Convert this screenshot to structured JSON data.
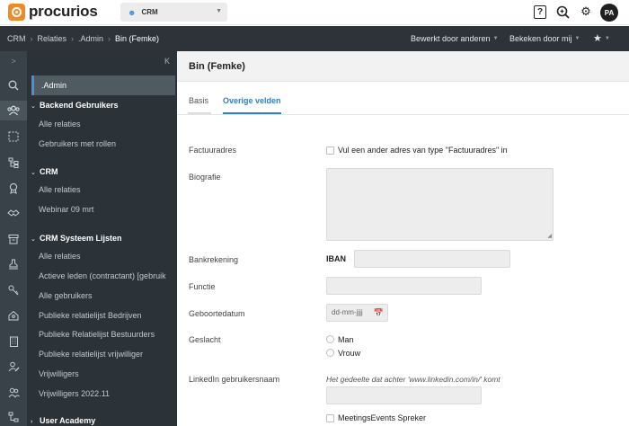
{
  "app": {
    "logo_text": "procurios",
    "module": "CRM",
    "avatar": "PA",
    "help": "?"
  },
  "breadcrumb": {
    "items": [
      "CRM",
      "Relaties",
      ".Admin"
    ],
    "current": "Bin (Femke)",
    "edited_by": "Bewerkt door anderen",
    "viewed_by": "Bekeken door mij"
  },
  "nav": {
    "collapse": "K",
    "rail_toggle": ">",
    "admin": ".Admin",
    "groups": [
      {
        "title": "Backend Gebruikers",
        "items": [
          "Alle relaties",
          "Gebruikers met rollen"
        ]
      },
      {
        "title": "CRM",
        "items": [
          "Alle relaties",
          "Webinar 09 mrt"
        ]
      },
      {
        "title": "CRM Systeem Lijsten",
        "items": [
          "Alle relaties",
          "Actieve leden (contractant) [gebruik",
          "Alle gebruikers",
          "Publieke relatielijst Bedrijven",
          "Publieke Relatielijst Bestuurders",
          "Publieke relatielijst vrijwilliger",
          "Vrijwilligers",
          "Vrijwilligers 2022.11"
        ]
      },
      {
        "title": "User Academy",
        "items": []
      }
    ]
  },
  "main": {
    "title": "Bin (Femke)",
    "tabs": [
      "Basis",
      "Overige velden"
    ],
    "active_tab": "Overige velden",
    "fields": {
      "factuuradres_label": "Factuuradres",
      "factuuradres_checkbox": "Vul een ander adres van type \"Factuuradres\" in",
      "biografie_label": "Biografie",
      "bankrekening_label": "Bankrekening",
      "iban_label": "IBAN",
      "functie_label": "Functie",
      "geboortedatum_label": "Geboortedatum",
      "geboortedatum_placeholder": "dd-mm-jjjj",
      "geslacht_label": "Geslacht",
      "geslacht_options": [
        "Man",
        "Vrouw"
      ],
      "linkedin_label": "LinkedIn gebruikersnaam",
      "linkedin_hint": "Het gedeelte dat achter 'www.linkedin.com/in/' komt",
      "meetings_checkbox": "MeetingsEvents Spreker"
    }
  },
  "colors": {
    "accent": "#2f7fc8",
    "brand": "#f08a24",
    "sidebar_bg": "#2c3338"
  }
}
